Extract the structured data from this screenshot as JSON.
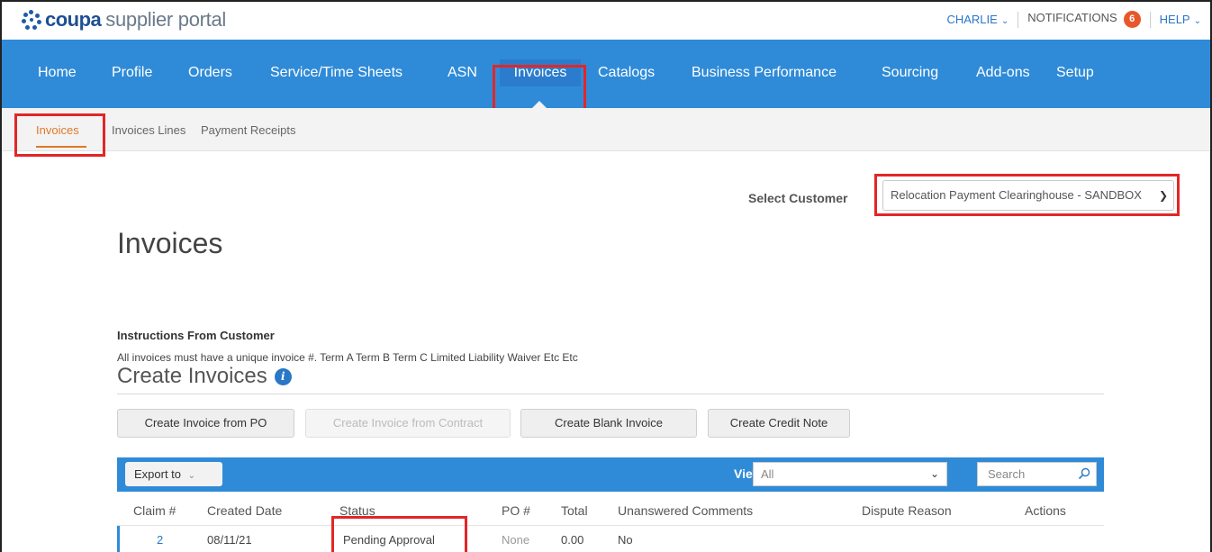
{
  "app": {
    "logo_word": "coupa",
    "logo_sub": "supplier portal"
  },
  "util": {
    "user": "CHARLIE",
    "notifications_label": "NOTIFICATIONS",
    "notifications_count": "6",
    "help": "HELP"
  },
  "nav": {
    "items": [
      "Home",
      "Profile",
      "Orders",
      "Service/Time Sheets",
      "ASN",
      "Invoices",
      "Catalogs",
      "Business Performance",
      "Sourcing",
      "Add-ons",
      "Setup"
    ],
    "active": "Invoices"
  },
  "subnav": {
    "items": [
      "Invoices",
      "Invoices Lines",
      "Payment Receipts"
    ],
    "active": "Invoices"
  },
  "customer": {
    "label": "Select Customer",
    "value": "Relocation Payment Clearinghouse - SANDBOX"
  },
  "page": {
    "title": "Invoices",
    "instructions_heading": "Instructions From Customer",
    "instructions_text": "All invoices must have a unique invoice #. Term A Term B Term C Limited Liability Waiver Etc Etc",
    "create_title": "Create Invoices"
  },
  "actions": {
    "create_from_po": "Create Invoice from PO",
    "create_from_contract": "Create Invoice from Contract",
    "create_blank": "Create Blank Invoice",
    "create_credit_note": "Create Credit Note"
  },
  "toolbar": {
    "export_label": "Export to",
    "view_label": "View",
    "view_value": "All",
    "search_placeholder": "Search"
  },
  "table": {
    "columns": [
      "Claim #",
      "Created Date",
      "Status",
      "PO #",
      "Total",
      "Unanswered Comments",
      "Dispute Reason",
      "Actions"
    ],
    "rows": [
      {
        "claim": "2",
        "created": "08/11/21",
        "status": "Pending Approval",
        "po": "None",
        "total": "0.00",
        "comments": "No",
        "dispute": "",
        "actions": ""
      }
    ]
  },
  "colors": {
    "nav_blue": "#2f8bd8",
    "highlight_red": "#e32626",
    "active_orange": "#e0782a",
    "badge_orange": "#e8572a"
  }
}
